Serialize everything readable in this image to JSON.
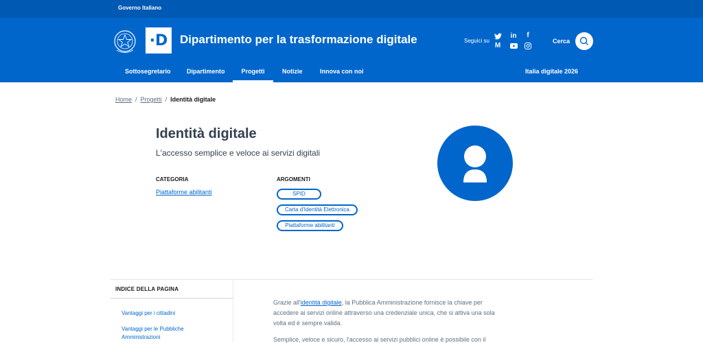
{
  "slim_header": {
    "label": "Governo Italiano"
  },
  "header": {
    "title": "Dipartimento per la trasformazione digitale",
    "logo_letter": "·D",
    "social_label": "Seguici su",
    "social_icons": [
      "twitter-icon",
      "linkedin-icon",
      "facebook-icon",
      "medium-icon",
      "youtube-icon",
      "instagram-icon"
    ],
    "search_label": "Cerca"
  },
  "nav": {
    "items": [
      "Sottosegretario",
      "Dipartimento",
      "Progetti",
      "Notizie",
      "Innova con noi"
    ],
    "active": "Progetti",
    "right_item": "Italia digitale 2026"
  },
  "breadcrumb": {
    "home": "Home",
    "section": "Progetti",
    "current": "Identità digitale",
    "separator": "/"
  },
  "hero": {
    "title": "Identità digitale",
    "subtitle": "L'accesso semplice e veloce ai servizi digitali",
    "category_label": "CATEGORIA",
    "category_value": "Piattaforme abilitanti",
    "topics_label": "ARGOMENTI",
    "topics": [
      "SPID",
      "Carta d'Identità Elettronica",
      "Piattaforme abilitanti"
    ]
  },
  "page_index": {
    "title": "INDICE DELLA PAGINA",
    "items": [
      "Vantaggi per i cittadini",
      "Vantaggi per le Pubbliche Amministrazioni"
    ]
  },
  "content": {
    "p1_prefix": "Grazie all'",
    "p1_link": "identità digitale",
    "p1_suffix": ", la Pubblica Amministrazione fornisce la chiave per accedere ai servizi online attraverso una credenziale unica, che si attiva una sola volta ed è sempre valida.",
    "p2": "Semplice, veloce e sicuro, l'accesso ai servizi pubblici online è possibile con il"
  },
  "colors": {
    "primary": "#0066cc",
    "slim": "#0059b3",
    "text_muted": "#5c6f82"
  }
}
